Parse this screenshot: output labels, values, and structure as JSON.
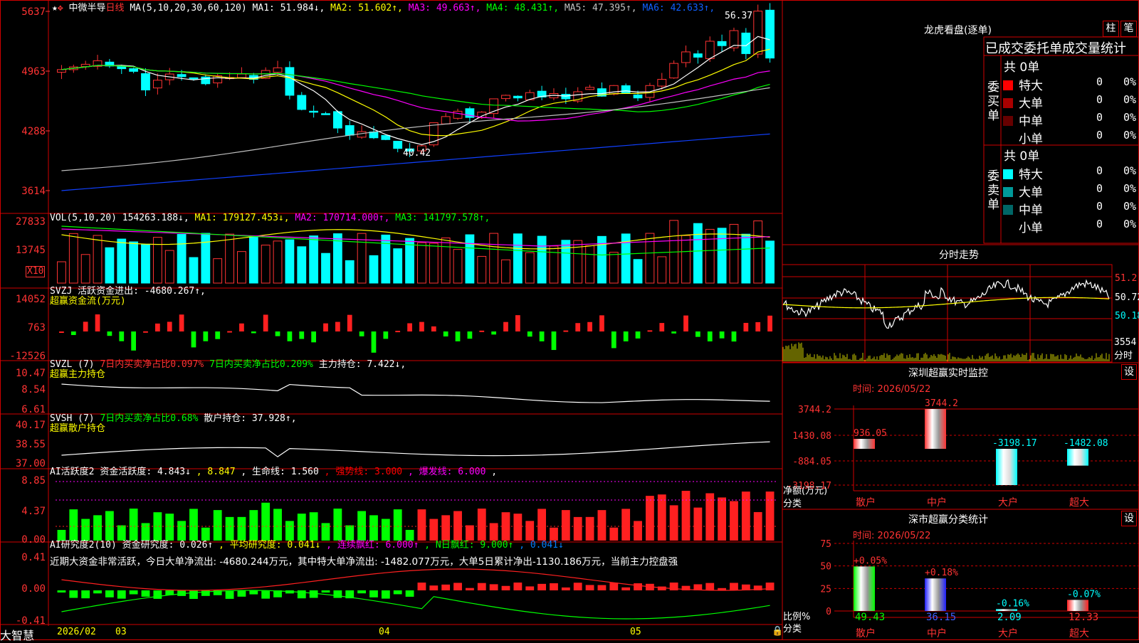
{
  "stock": {
    "name": "中微半导",
    "period": "日线"
  },
  "ma_params": "MA(5,10,20,30,60,120)",
  "ma_values": [
    {
      "label": "MA1:",
      "value": "51.984",
      "arrow": "↓",
      "color": "#ffffff"
    },
    {
      "label": "MA2:",
      "value": "51.602",
      "arrow": "↑",
      "color": "#ffff00"
    },
    {
      "label": "MA3:",
      "value": "49.663",
      "arrow": "↑",
      "color": "#ff00ff"
    },
    {
      "label": "MA4:",
      "value": "48.431",
      "arrow": "↑",
      "color": "#00ff00"
    },
    {
      "label": "MA5:",
      "value": "47.395",
      "arrow": "↑",
      "color": "#c0c0c0"
    },
    {
      "label": "MA6:",
      "value": "42.633",
      "arrow": "↑",
      "color": "#1060ff"
    }
  ],
  "price_axis": [
    "5637",
    "4963",
    "4288",
    "3614"
  ],
  "price_high_label": "56.37",
  "price_low_label": "40.42",
  "vol_header": {
    "params": "VOL(5,10,20)",
    "items": [
      {
        "value": "154263.188",
        "arrow": "↓",
        "color": "#ffffff"
      },
      {
        "value": "MA1: 179127.453",
        "arrow": "↓",
        "color": "#ffff00"
      },
      {
        "value": "MA2: 170714.000",
        "arrow": "↑",
        "color": "#ff00ff"
      },
      {
        "value": "MA3: 141797.578",
        "arrow": "↑",
        "color": "#00ff00"
      }
    ]
  },
  "vol_axis": [
    "27833",
    "13745"
  ],
  "vol_unit": "X10",
  "svzj": {
    "title": "SVZJ",
    "label": "活跃资金进出: -4680.267↑,",
    "sub": "超赢资金流(万元)",
    "axis": [
      "14052",
      "763",
      "-12526"
    ]
  },
  "svzl": {
    "title": "SVZL (7)",
    "t1": "7日内买卖净占比0.097%",
    "t2": "7日内买卖净占比0.209%",
    "t3": "主力持仓: 7.422↓,",
    "sub": "超赢主力持仓",
    "axis": [
      "10.47",
      "8.54",
      "6.61"
    ]
  },
  "svsh": {
    "title": "SVSH (7)",
    "t1": "7日内买卖净占比0.68%",
    "t2": "散户持仓: 37.928↑,",
    "sub": "超赢散户持仓",
    "axis": [
      "40.17",
      "38.55",
      "37.00"
    ]
  },
  "ai1": {
    "parts": [
      {
        "text": "AI活跃度2",
        "color": "#ffffff"
      },
      {
        "text": "资金活跃度: 4.843↓",
        "color": "#ffffff"
      },
      {
        "text": ", 8.847",
        "color": "#ffff00"
      },
      {
        "text": ", 生命线: 1.560",
        "color": "#ffffff"
      },
      {
        "text": ", 强势线: 3.000",
        "color": "#ff0000"
      },
      {
        "text": ", 爆发线: 6.000",
        "color": "#ff00ff"
      },
      {
        "text": ",",
        "color": "#ffffff"
      }
    ],
    "axis": [
      "8.85",
      "4.37",
      "0.00"
    ]
  },
  "ai2": {
    "parts": [
      {
        "text": "AI研究度2(10)",
        "color": "#ffffff"
      },
      {
        "text": "资金研究度: 0.026↑",
        "color": "#ffffff"
      },
      {
        "text": ", 平均研究度: 0.041↓",
        "color": "#ffff00"
      },
      {
        "text": ", 连续飘红: 6.000↑",
        "color": "#ff00ff"
      },
      {
        "text": ", N日飘红: 9.000↑",
        "color": "#00ff00"
      },
      {
        "text": ", 0.041↓",
        "color": "#0080ff"
      }
    ],
    "comment": "近期大资金非常活跃，今日大单净流出: -4680.244万元，其中特大单净流出: -1482.077万元，大单5日累计净出-1130.186万元，当前主力控盘强",
    "axis": [
      "0.41",
      "0.00",
      "-0.41"
    ]
  },
  "date_axis": [
    "2026/02",
    "03",
    "04",
    "05"
  ],
  "brand": "大智慧",
  "longhu": {
    "title": "龙虎看盘(逐单)",
    "btn_bar": "柱",
    "btn_pen": "笔",
    "header": "已成交委托单成交量统计",
    "buy": {
      "label": "委买单",
      "count": "共 0单",
      "rows": [
        {
          "name": "特大",
          "v": "0",
          "p": "0%",
          "color": "#ff0000"
        },
        {
          "name": "大单",
          "v": "0",
          "p": "0%",
          "color": "#aa0000"
        },
        {
          "name": "中单",
          "v": "0",
          "p": "0%",
          "color": "#660000"
        },
        {
          "name": "小单",
          "v": "0",
          "p": "0%",
          "color": ""
        }
      ]
    },
    "sell": {
      "label": "委卖单",
      "count": "共 0单",
      "rows": [
        {
          "name": "特大",
          "v": "0",
          "p": "0%",
          "color": "#00ffff"
        },
        {
          "name": "大单",
          "v": "0",
          "p": "0%",
          "color": "#009999"
        },
        {
          "name": "中单",
          "v": "0",
          "p": "0%",
          "color": "#006666"
        },
        {
          "name": "小单",
          "v": "0",
          "p": "0%",
          "color": ""
        }
      ]
    }
  },
  "intraday": {
    "title": "分时走势",
    "axis": [
      "51.2",
      "50.72",
      "50.18"
    ],
    "vol": "3554",
    "vol_unit": "分时"
  },
  "monitor": {
    "title": "深圳超赢实时监控",
    "btn": "设",
    "time": "时间: 2026/05/22",
    "axis": [
      "3744.2",
      "1430.08",
      "-884.05",
      "-3198.17"
    ],
    "ylabel": "净额(万元)",
    "xlabel": "分类",
    "categories": [
      "散户",
      "中户",
      "大户",
      "超大"
    ],
    "values": [
      936.05,
      3744.2,
      -3198.17,
      -1482.08
    ],
    "value_labels": [
      "936.05",
      "3744.2",
      "-3198.17",
      "-1482.08"
    ]
  },
  "classify": {
    "title": "深市超赢分类统计",
    "btn": "设",
    "time": "时间: 2026/05/22",
    "axis": [
      "75",
      "50",
      "25",
      "0"
    ],
    "ylabel": "比例%",
    "xlabel": "分类",
    "categories": [
      "散户",
      "中户",
      "大户",
      "超大"
    ],
    "values": [
      49.43,
      36.15,
      2.09,
      12.33
    ],
    "value_labels": [
      "49.43",
      "36.15",
      "2.09",
      "12.33"
    ],
    "changes": [
      "+0.05%",
      "+0.18%",
      "-0.16%",
      "-0.07%"
    ]
  }
}
